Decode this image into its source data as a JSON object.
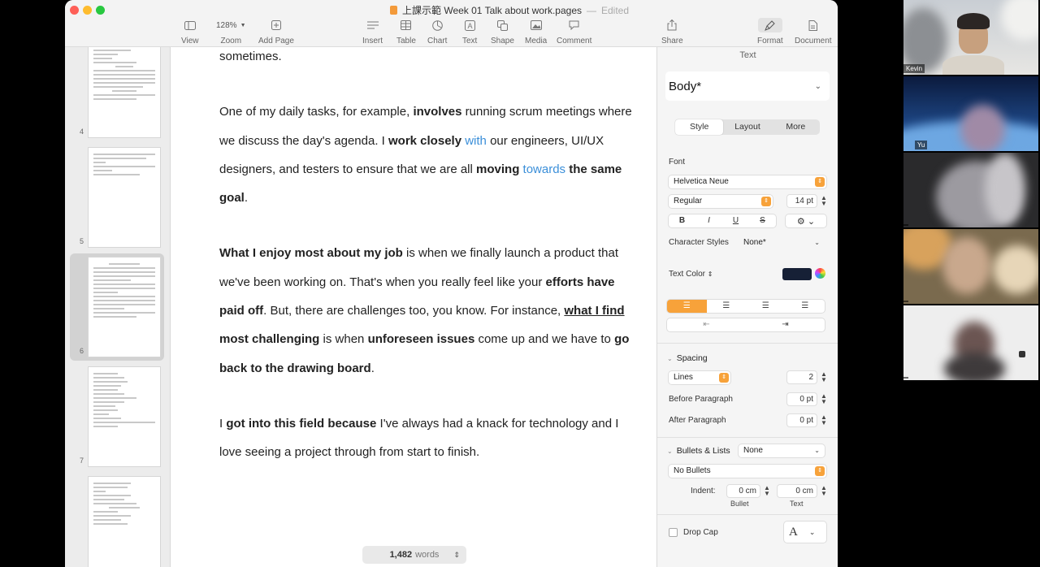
{
  "window": {
    "title": "上課示範 Week 01 Talk about work.pages",
    "title_sep": "—",
    "status": "Edited"
  },
  "toolbar": {
    "view": "View",
    "zoom_value": "128%",
    "zoom": "Zoom",
    "add_page": "Add Page",
    "insert": "Insert",
    "table": "Table",
    "chart": "Chart",
    "text": "Text",
    "shape": "Shape",
    "media": "Media",
    "comment": "Comment",
    "share": "Share",
    "format": "Format",
    "document": "Document"
  },
  "thumbnails": {
    "page_numbers": [
      "4",
      "5",
      "6",
      "7"
    ],
    "selected": "6"
  },
  "document": {
    "p0": "sometimes.",
    "p1": [
      {
        "t": "One of my daily tasks, for example, ",
        "s": ""
      },
      {
        "t": "involves",
        "s": "b"
      },
      {
        "t": " running scrum meetings where we discuss the day's agenda. I ",
        "s": ""
      },
      {
        "t": "work closely",
        "s": "b"
      },
      {
        "t": " ",
        "s": ""
      },
      {
        "t": "with",
        "s": "blue"
      },
      {
        "t": " our engineers, UI/UX designers, and testers to ensure that we are all ",
        "s": ""
      },
      {
        "t": "moving",
        "s": "b"
      },
      {
        "t": " ",
        "s": ""
      },
      {
        "t": "towards",
        "s": "blue"
      },
      {
        "t": " ",
        "s": ""
      },
      {
        "t": "the same goal",
        "s": "b"
      },
      {
        "t": ".",
        "s": ""
      }
    ],
    "p2": [
      {
        "t": "What I enjoy most about my job",
        "s": "b"
      },
      {
        "t": " is when we finally launch a product that we've been working on. That's when you really feel like your ",
        "s": ""
      },
      {
        "t": "efforts have paid off",
        "s": "b"
      },
      {
        "t": ". But, there are challenges too, you know. For instance, ",
        "s": ""
      },
      {
        "t": "what I find",
        "s": "bu"
      },
      {
        "t": " ",
        "s": ""
      },
      {
        "t": "most challenging",
        "s": "b"
      },
      {
        "t": " is when ",
        "s": ""
      },
      {
        "t": "unforeseen issues",
        "s": "b"
      },
      {
        "t": " come up and we have to ",
        "s": ""
      },
      {
        "t": "go back to the drawing board",
        "s": "b"
      },
      {
        "t": ".",
        "s": ""
      }
    ],
    "p3": [
      {
        "t": "I ",
        "s": ""
      },
      {
        "t": "got into this field because",
        "s": "b"
      },
      {
        "t": " I've always had a knack for technology and I love seeing a project through from start to finish.",
        "s": ""
      }
    ]
  },
  "wordcount": {
    "value": "1,482",
    "label": "words"
  },
  "inspector": {
    "header": "Text",
    "paragraph_style": "Body*",
    "tabs": [
      "Style",
      "Layout",
      "More"
    ],
    "font_label": "Font",
    "font_family": "Helvetica Neue",
    "font_weight": "Regular",
    "font_size": "14 pt",
    "format_buttons": [
      "B",
      "I",
      "U",
      "S"
    ],
    "character_styles_label": "Character Styles",
    "character_styles_value": "None*",
    "text_color_label": "Text Color",
    "text_color": "#162036",
    "spacing_label": "Spacing",
    "spacing_mode": "Lines",
    "spacing_value": "2",
    "before_paragraph_label": "Before Paragraph",
    "before_paragraph_value": "0 pt",
    "after_paragraph_label": "After Paragraph",
    "after_paragraph_value": "0 pt",
    "bullets_label": "Bullets & Lists",
    "bullets_value": "None",
    "bullets_style": "No Bullets",
    "indent_label": "Indent:",
    "indent_bullet_value": "0 cm",
    "indent_text_value": "0 cm",
    "indent_bullet_label": "Bullet",
    "indent_text_label": "Text",
    "drop_cap_label": "Drop Cap"
  },
  "video_call": {
    "participants": [
      {
        "name": "Kevin"
      },
      {
        "name": "Yu"
      },
      {
        "name": ""
      },
      {
        "name": ""
      },
      {
        "name": ""
      }
    ]
  }
}
